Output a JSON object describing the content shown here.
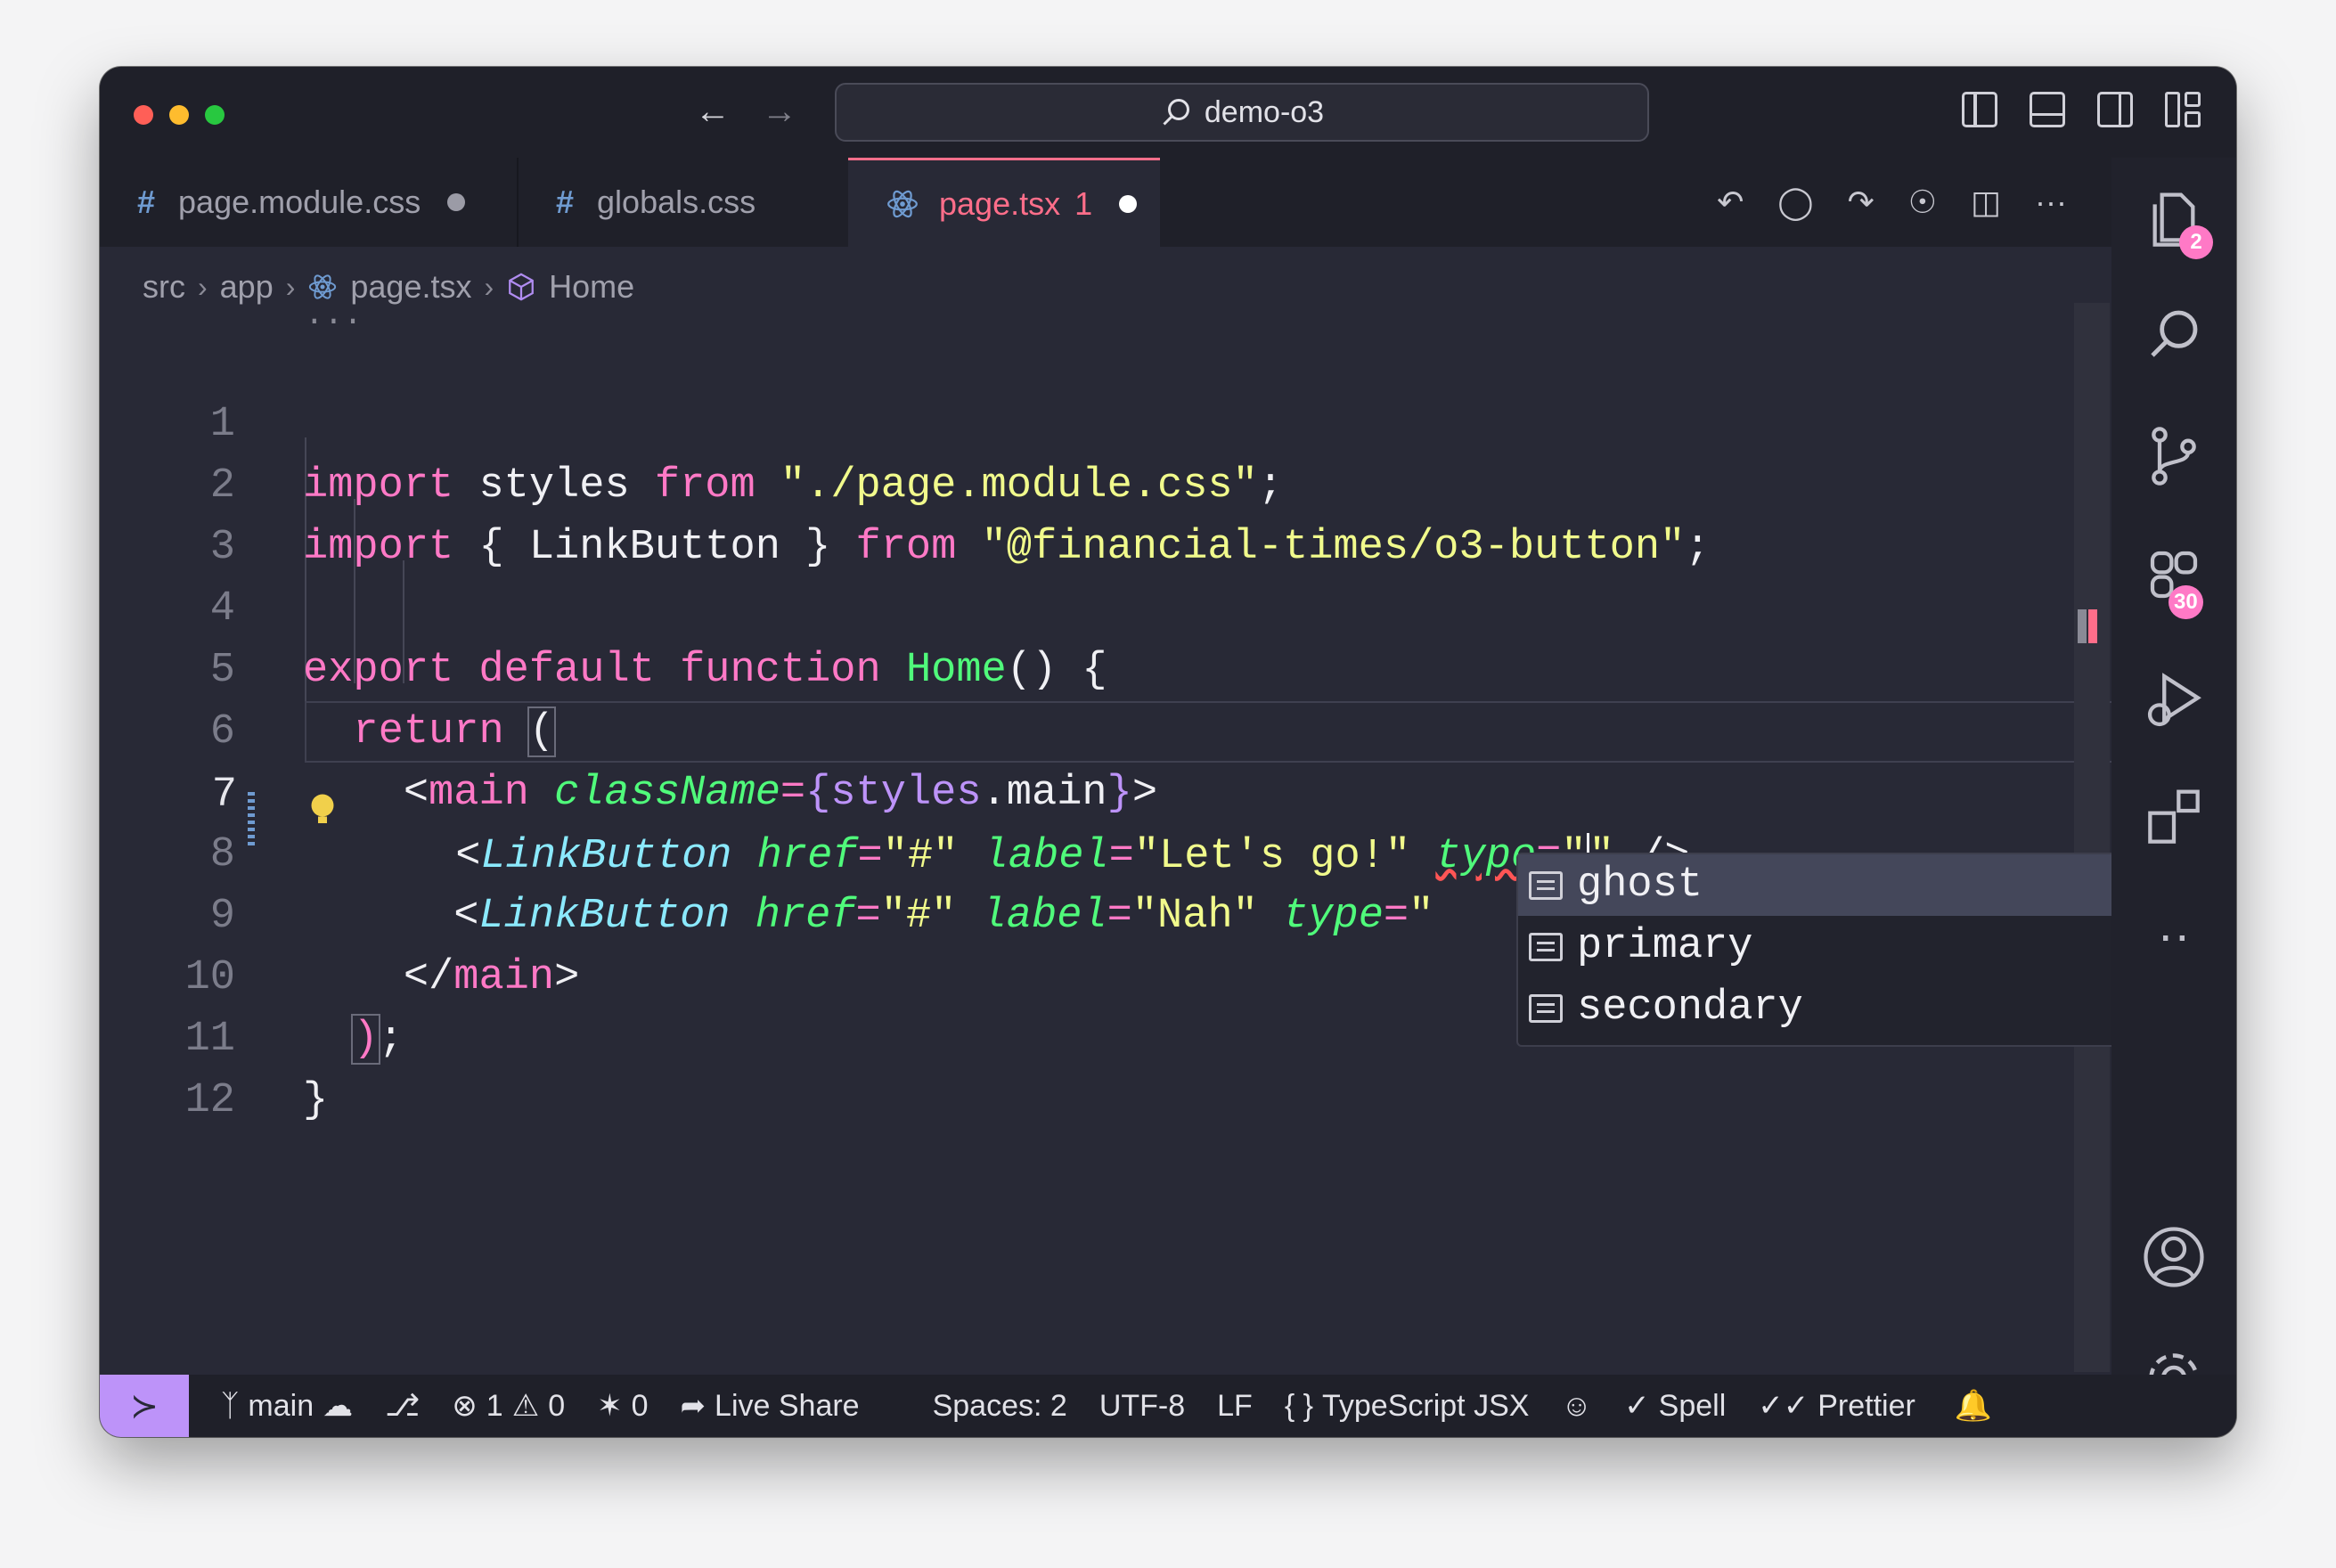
{
  "window": {
    "search_text": "demo-o3"
  },
  "tabs": [
    {
      "label": "page.module.css",
      "icon": "hash-icon",
      "dirty": true
    },
    {
      "label": "globals.css",
      "icon": "hash-icon",
      "dirty": false
    },
    {
      "label": "page.tsx",
      "icon": "react-icon",
      "problems": "1",
      "dirty": true,
      "active": true
    }
  ],
  "breadcrumb": [
    "src",
    "app",
    "page.tsx",
    "Home"
  ],
  "editor": {
    "folded_marker": "...",
    "line_numbers": [
      "1",
      "2",
      "3",
      "4",
      "5",
      "6",
      "7",
      "8",
      "9",
      "10",
      "11",
      "12"
    ],
    "active_line": "7"
  },
  "suggestions": [
    {
      "label": "ghost",
      "selected": true
    },
    {
      "label": "primary",
      "selected": false
    },
    {
      "label": "secondary",
      "selected": false
    }
  ],
  "activity": {
    "explorer_badge": "2",
    "extensions_badge": "30"
  },
  "status": {
    "branch": "main",
    "errors": "1",
    "warnings": "0",
    "ports": "0",
    "live_share": "Live Share",
    "spaces": "Spaces: 2",
    "encoding": "UTF-8",
    "eol": "LF",
    "language": "TypeScript JSX",
    "spell": "Spell",
    "prettier": "Prettier"
  },
  "colors": {
    "accent": "#ff6e8a",
    "remote": "#bd93f9",
    "background": "#282936"
  }
}
